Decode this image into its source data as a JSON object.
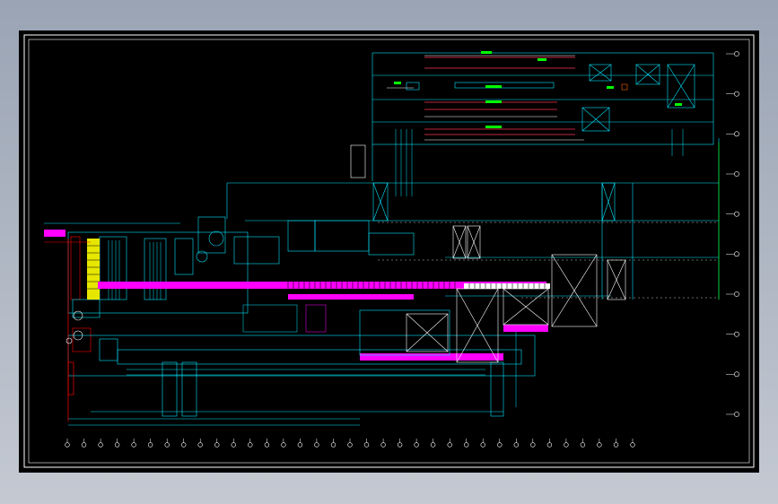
{
  "viewer": {
    "background_top": "#9aa4b4",
    "background_bottom": "#c4c9d2",
    "canvas_color": "#000000"
  },
  "drawing": {
    "colors": {
      "frame": "#ffffff",
      "main": "#00e5ff",
      "conveyor": "#ff00ff",
      "accent": "#ffff00",
      "dimension": "#00ff00",
      "marker": "#ff0000"
    },
    "grid_axes": {
      "bottom_count": 35,
      "right_count": 10
    },
    "labels": []
  }
}
